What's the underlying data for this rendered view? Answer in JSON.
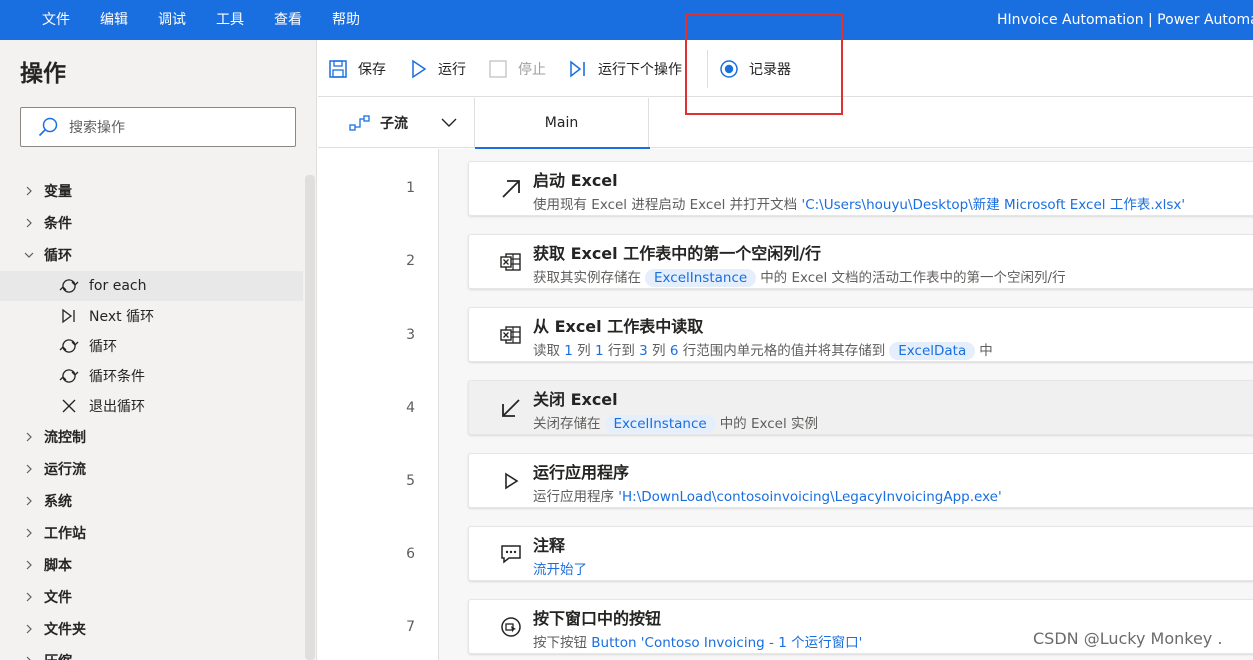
{
  "menu": [
    "文件",
    "编辑",
    "调试",
    "工具",
    "查看",
    "帮助"
  ],
  "app_title": "HInvoice Automation | Power Automate",
  "left_panel": {
    "title": "操作",
    "search_placeholder": "搜索操作",
    "categories_top": [
      "变量",
      "条件",
      "循环"
    ],
    "loop_children": [
      "for each",
      "Next 循环",
      "循环",
      "循环条件",
      "退出循环"
    ],
    "categories_bottom": [
      "流控制",
      "运行流",
      "系统",
      "工作站",
      "脚本",
      "文件",
      "文件夹",
      "压缩"
    ]
  },
  "toolbar": {
    "save": "保存",
    "run": "运行",
    "stop": "停止",
    "run_next": "运行下个操作",
    "recorder": "记录器"
  },
  "tabs": {
    "subflow": "子流",
    "main": "Main"
  },
  "steps": [
    {
      "num": "1",
      "title": "启动 Excel",
      "desc_pre": "使用现有 Excel 进程启动 Excel 并打开文档 ",
      "desc_link": "'C:\\Users\\houyu\\Desktop\\新建 Microsoft Excel 工作表.xlsx'"
    },
    {
      "num": "2",
      "title": "获取 Excel 工作表中的第一个空闲列/行",
      "desc_pre": "获取其实例存储在",
      "var": "ExcelInstance",
      "desc_post": "中的 Excel 文档的活动工作表中的第一个空闲列/行"
    },
    {
      "num": "3",
      "title": "从 Excel 工作表中读取",
      "d1": "读取 ",
      "n1": "1",
      "d2": " 列 ",
      "n2": "1",
      "d3": " 行到 ",
      "n3": "3",
      "d4": " 列 ",
      "n4": "6",
      "d5": " 行范围内单元格的值并将其存储到",
      "var": "ExcelData",
      "desc_post": "中"
    },
    {
      "num": "4",
      "title": "关闭 Excel",
      "desc_pre": "关闭存储在",
      "var": "ExcelInstance",
      "desc_post": "中的 Excel 实例"
    },
    {
      "num": "5",
      "title": "运行应用程序",
      "desc_pre": "运行应用程序 ",
      "desc_link": "'H:\\DownLoad\\contosoinvoicing\\LegacyInvoicingApp.exe'"
    },
    {
      "num": "6",
      "title": "注释",
      "desc_link": "流开始了"
    },
    {
      "num": "7",
      "title": "按下窗口中的按钮",
      "desc_pre": "按下按钮 ",
      "desc_link": "Button 'Contoso Invoicing - 1 个运行窗口'"
    }
  ],
  "watermark": "CSDN @Lucky Monkey ."
}
